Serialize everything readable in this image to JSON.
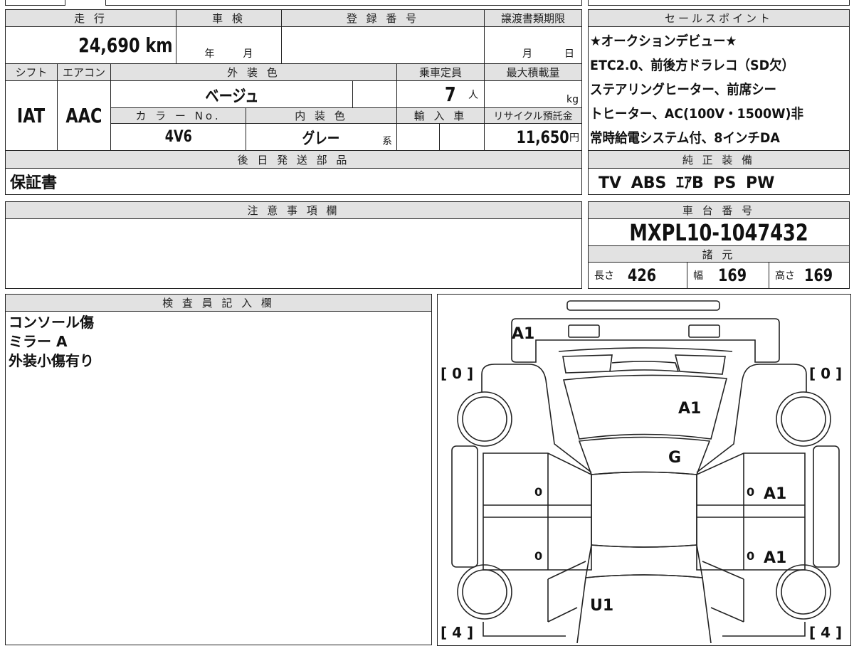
{
  "main": {
    "mileage_label": "走 行",
    "mileage": "24,690 km",
    "inspection_label": "車 検",
    "inspection_year": "年",
    "inspection_month": "月",
    "reg_label": "登 録 番 号",
    "transfer_label": "譲渡書類期限",
    "transfer_month": "月",
    "transfer_day": "日",
    "shift_label": "シフト",
    "shift": "IAT",
    "ac_label": "エアコン",
    "ac": "AAC",
    "ext_color_label": "外 装 色",
    "ext_color": "ベージュ",
    "capacity_label": "乗車定員",
    "capacity": "7",
    "capacity_unit": "人",
    "max_load_label": "最大積載量",
    "max_load_unit": "kg",
    "color_no_label": "カ ラ ー No.",
    "color_no": "4V6",
    "int_color_label": "内 装 色",
    "int_color": "グレー",
    "int_color_suffix": "系",
    "import_label": "輸 入 車",
    "recycle_label": "リサイクル預託金",
    "recycle": "11,650",
    "recycle_unit": "円",
    "later_parts_label": "後 日 発 送 部 品",
    "later_parts": "保証書"
  },
  "sales": {
    "label": "セールスポイント",
    "lines": [
      "★オークションデビュー★",
      "ETC2.0、前後方ドラレコ（SD欠）",
      "ステアリングヒーター、前席シー",
      "トヒーター、AC(100V・1500W)非",
      "常時給電システム付、8インチDA"
    ]
  },
  "equipment": {
    "label": "純 正 装 備",
    "items": "TV ABS ｴｱB PS PW"
  },
  "notes": {
    "label": "注 意 事 項 欄"
  },
  "chassis": {
    "label": "車 台 番 号",
    "value": "MXPL10-1047432",
    "specs_label": "諸 元",
    "length_label": "長さ",
    "length": "426",
    "width_label": "幅",
    "width": "169",
    "height_label": "高さ",
    "height": "169"
  },
  "inspector": {
    "label": "検 査 員 記 入 欄",
    "lines": [
      "コンソール傷",
      "ミラー A",
      "外装小傷有り"
    ]
  },
  "diagram": {
    "marks": {
      "front_bumper": "A1",
      "hood": "A1",
      "windshield": "G",
      "lf_door": "0",
      "lr_door": "0",
      "rf_door_num": "0",
      "rf_door": "A1",
      "rr_door_num": "0",
      "rr_door": "A1",
      "trunk": "U1"
    },
    "tires": {
      "fl": "[ 0 ]",
      "fr": "[ 0 ]",
      "rl": "[ 4 ]",
      "rr": "[ 4 ]"
    }
  }
}
